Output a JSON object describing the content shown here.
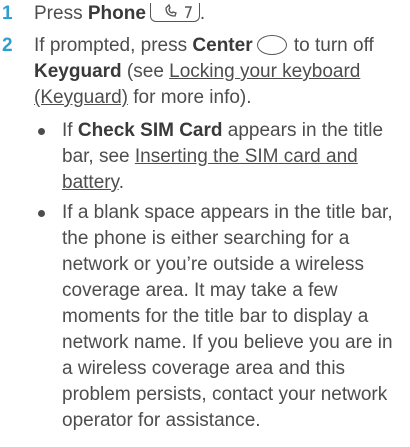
{
  "steps": [
    {
      "number": "1",
      "pre": "Press ",
      "bold": "Phone",
      "icon": "phone-key-icon",
      "post": "."
    },
    {
      "number": "2",
      "pre": "If prompted, press ",
      "bold": "Center",
      "icon": "center-key-icon",
      "mid": " to turn off ",
      "bold2": "Keyguard",
      "mid2": " (see ",
      "link": "Locking your keyboard (Keyguard)",
      "post": " for more info)."
    }
  ],
  "bullets": [
    {
      "pre": "If ",
      "bold": "Check SIM Card",
      "mid": " appears in the title bar, see ",
      "link": "Inserting the SIM card and battery",
      "post": "."
    },
    {
      "text": "If a blank space appears in the title bar, the phone is either searching for a network or you’re outside a wireless coverage area. It may take a few moments for the title bar to display a network name. If you believe you are in a wireless coverage area and this problem persists, contact your network operator for assistance."
    }
  ],
  "colors": {
    "step_number": "#2d9fd0",
    "text": "#4d4d4d"
  }
}
